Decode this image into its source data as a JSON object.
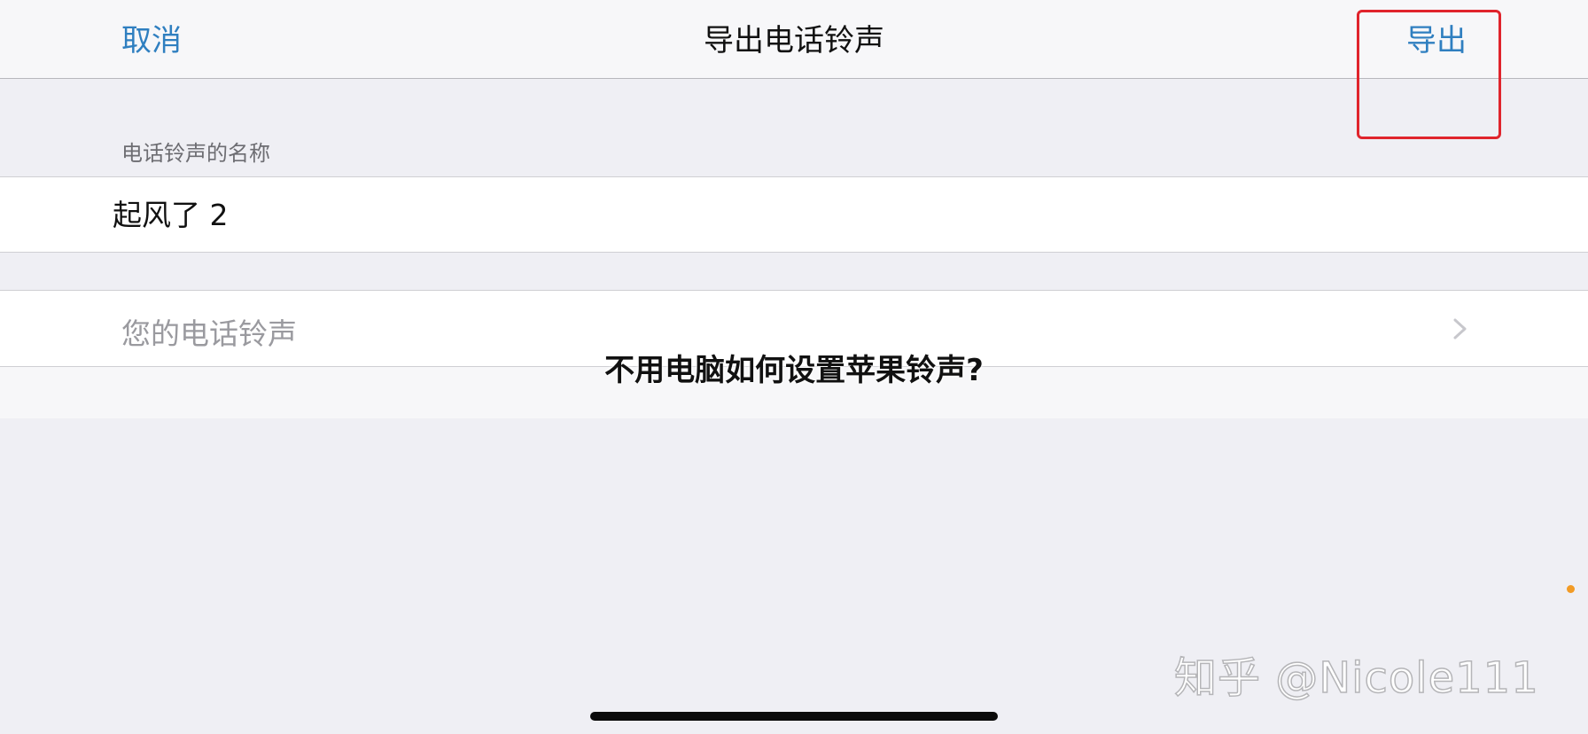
{
  "navbar": {
    "cancel_label": "取消",
    "title": "导出电话铃声",
    "export_label": "导出"
  },
  "name_section": {
    "header": "电话铃声的名称",
    "value": "起风了 2"
  },
  "ringtones_cell": {
    "label": "您的电话铃声",
    "icon": "chevron-right-icon"
  },
  "overlay": {
    "title": "不用电脑如何设置苹果铃声?"
  },
  "watermark": {
    "text": "知乎 @Nicole111"
  },
  "colors": {
    "accent": "#2f7fc0",
    "highlight": "#e0242c",
    "background": "#efeff4"
  }
}
